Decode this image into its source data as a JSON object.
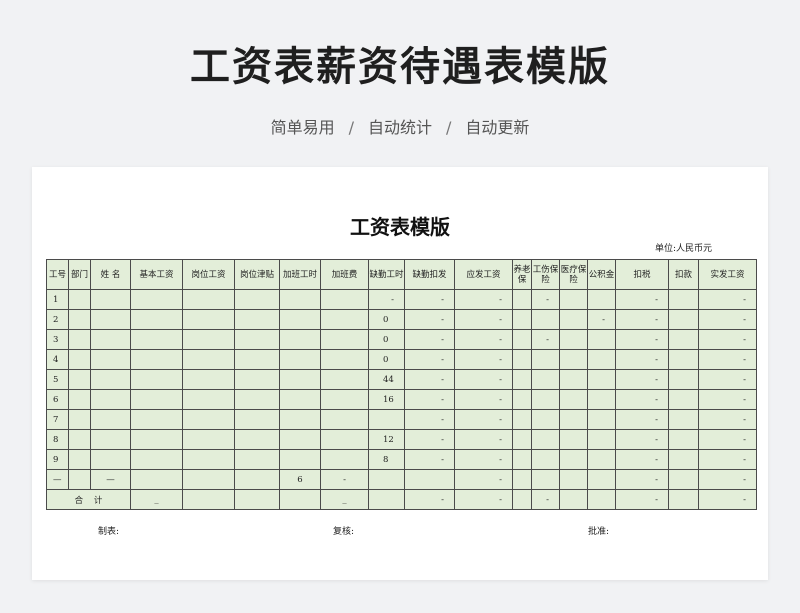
{
  "banner": {
    "title": "工资表薪资待遇表模版",
    "subtitle": [
      "简单易用",
      "自动统计",
      "自动更新"
    ],
    "separator": "/"
  },
  "sheet": {
    "title": "工资表模版",
    "unit": "单位:人民币元",
    "headers": [
      "工号",
      "部门",
      "姓  名",
      "基本工资",
      "岗位工资",
      "岗位津贴",
      "加班工时",
      "加班费",
      "缺勤工时",
      "缺勤扣发",
      "应发工资",
      "养老保",
      "工伤保险",
      "医疗保险",
      "公积金",
      "扣税",
      "扣款",
      "实发工资"
    ],
    "rows": [
      [
        "1",
        "",
        "",
        "",
        "",
        "",
        "",
        "",
        "-",
        "-",
        "-",
        "",
        "-",
        "",
        "",
        "-",
        "",
        "-"
      ],
      [
        "2",
        "",
        "",
        "",
        "",
        "",
        "",
        "",
        "0",
        "-",
        "-",
        "",
        "",
        "",
        "-",
        "-",
        "",
        "-"
      ],
      [
        "3",
        "",
        "",
        "",
        "",
        "",
        "",
        "",
        "0",
        "-",
        "-",
        "",
        "-",
        "",
        "",
        "-",
        "",
        "-"
      ],
      [
        "4",
        "",
        "",
        "",
        "",
        "",
        "",
        "",
        "0",
        "-",
        "-",
        "",
        "",
        "",
        "",
        "-",
        "",
        "-"
      ],
      [
        "5",
        "",
        "",
        "",
        "",
        "",
        "",
        "",
        "44",
        "-",
        "-",
        "",
        "",
        "",
        "",
        "-",
        "",
        "-"
      ],
      [
        "6",
        "",
        "",
        "",
        "",
        "",
        "",
        "",
        "16",
        "-",
        "-",
        "",
        "",
        "",
        "",
        "-",
        "",
        "-"
      ],
      [
        "7",
        "",
        "",
        "",
        "",
        "",
        "",
        "",
        "",
        "-",
        "-",
        "",
        "",
        "",
        "",
        "-",
        "",
        "-"
      ],
      [
        "8",
        "",
        "",
        "",
        "",
        "",
        "",
        "",
        "12",
        "-",
        "-",
        "",
        "",
        "",
        "",
        "-",
        "",
        "-"
      ],
      [
        "9",
        "",
        "",
        "",
        "",
        "",
        "",
        "",
        "8",
        "-",
        "-",
        "",
        "",
        "",
        "",
        "-",
        "",
        "-"
      ],
      [
        "—",
        "",
        "—",
        "",
        "",
        "",
        "6",
        "-",
        "",
        "",
        "-",
        "",
        "",
        "",
        "",
        "-",
        "",
        "-"
      ]
    ],
    "total": {
      "label": "合    计",
      "cells": [
        "_",
        "",
        "",
        "",
        "_",
        "",
        "-",
        "-",
        "",
        "-",
        "",
        "",
        "-",
        "",
        "-"
      ]
    },
    "footer": {
      "maker": "制表:",
      "reviewer": "复核:",
      "approver": "批准:"
    }
  },
  "colors": {
    "page_background": "#f1f2f4",
    "cell_fill": "#e3eed9",
    "border": "#4b4b4b"
  }
}
